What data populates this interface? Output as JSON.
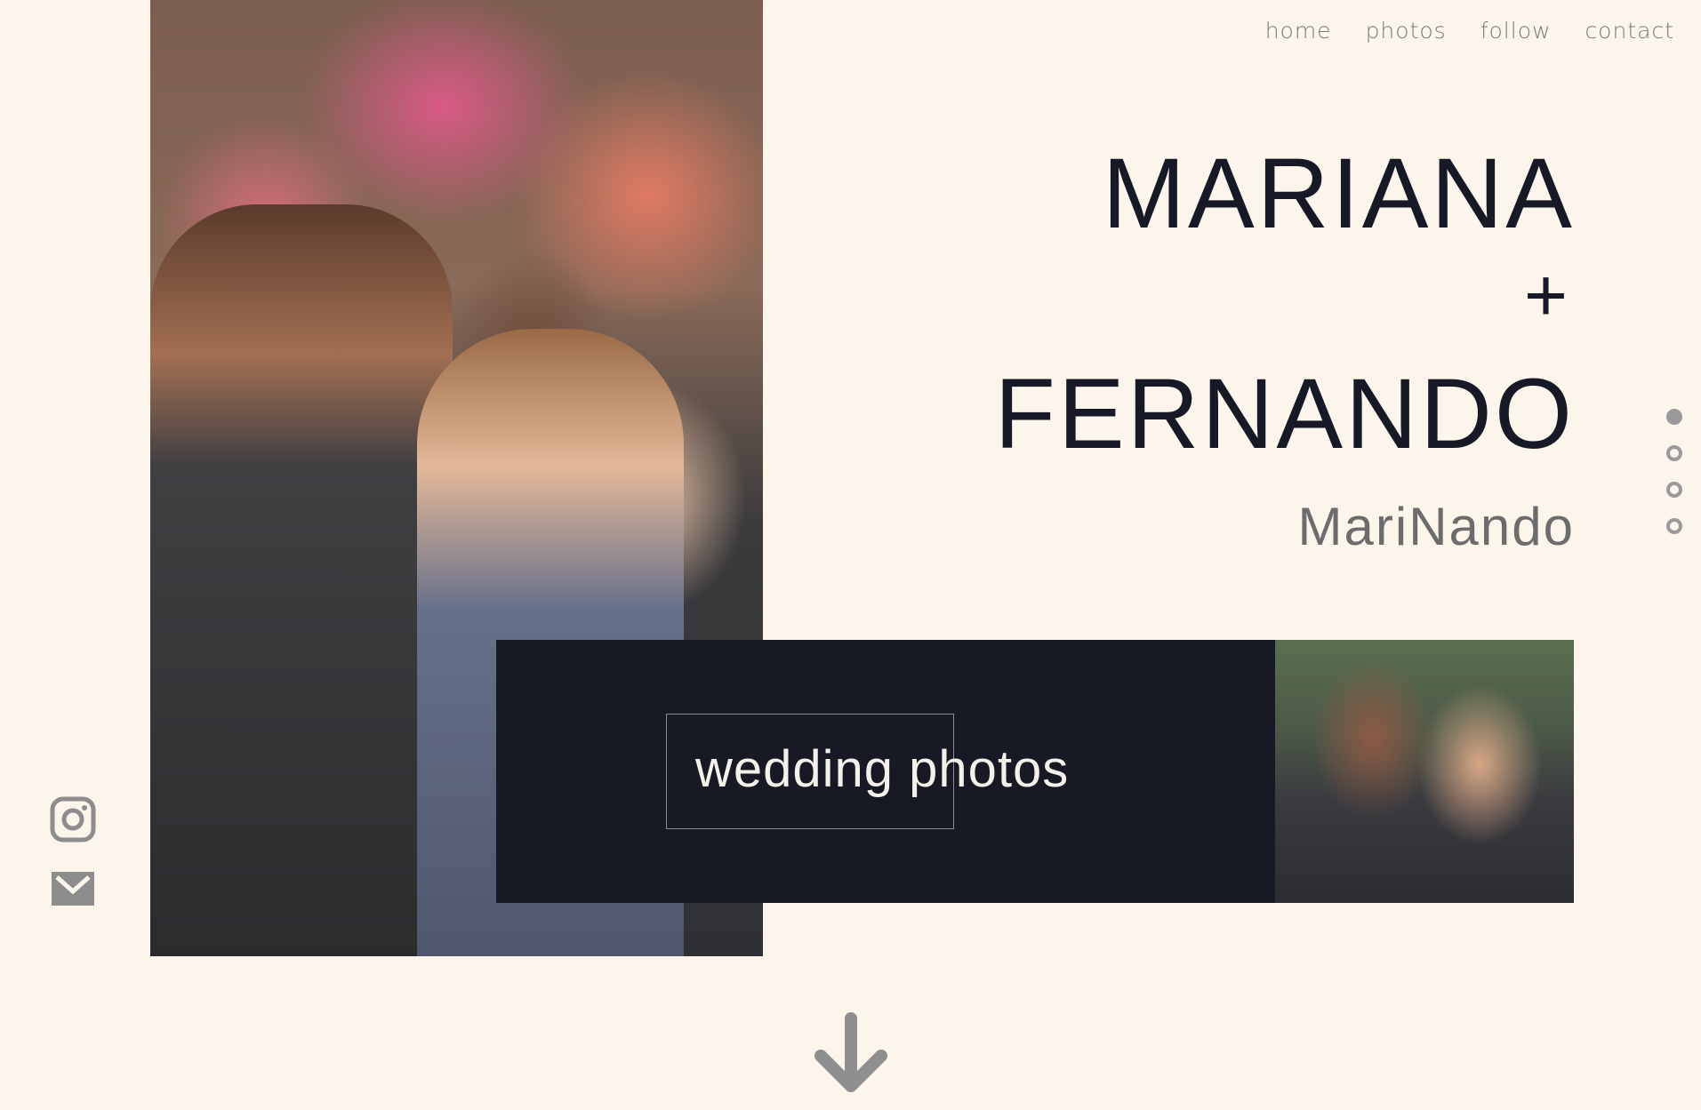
{
  "nav": {
    "items": [
      {
        "label": "home"
      },
      {
        "label": "photos"
      },
      {
        "label": "follow"
      },
      {
        "label": "contact"
      }
    ]
  },
  "hero": {
    "name_first": "MARIANA",
    "plus": "+",
    "name_second": "FERNANDO",
    "subtitle": "MariNando"
  },
  "banner": {
    "label": "wedding photos"
  },
  "slider": {
    "count": 4,
    "active_index": 0
  },
  "social": {
    "icons": [
      "instagram-icon",
      "mail-icon"
    ]
  },
  "colors": {
    "background": "#fcf5ec",
    "banner": "#171924",
    "title": "#171a26",
    "muted": "#7a7a7a"
  }
}
